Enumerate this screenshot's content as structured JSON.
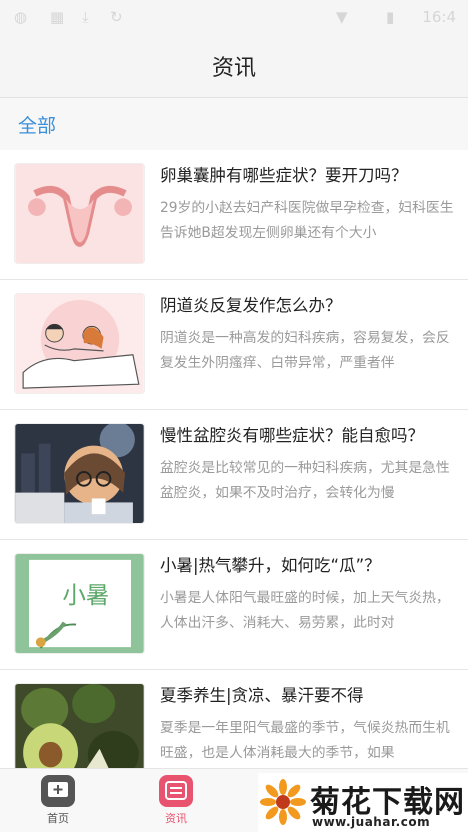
{
  "status_bar": {
    "time": "16:4",
    "icons": [
      "app-icon",
      "sim-icon",
      "download-icon",
      "sync-icon",
      "wifi-icon",
      "battery-icon"
    ]
  },
  "header": {
    "title": "资讯"
  },
  "filter": {
    "label": "全部"
  },
  "articles": [
    {
      "title": "卵巢囊肿有哪些症状？要开刀吗？",
      "desc": "29岁的小赵去妇产科医院做早孕检查，妇科医生告诉她B超发现左侧卵巢还有个大小",
      "thumb": "uterus-illustration"
    },
    {
      "title": "阴道炎反复发作怎么办？",
      "desc": "阴道炎是一种高发的妇科疾病，容易复发，会反复发生外阴瘙痒、白带异常，严重者伴",
      "thumb": "couple-illustration"
    },
    {
      "title": "慢性盆腔炎有哪些症状？能自愈吗？",
      "desc": "盆腔炎是比较常见的一种妇科疾病，尤其是急性盆腔炎，如果不及时治疗，会转化为慢",
      "thumb": "tired-woman-illustration"
    },
    {
      "title": "小暑|热气攀升，如何吃“瓜”？",
      "desc": "小暑是人体阳气最旺盛的时候，加上天气炎热，人体出汗多、消耗大、易劳累，此时对",
      "thumb": "xiaoshu-poster",
      "thumb_text": "小暑"
    },
    {
      "title": "夏季养生|贪凉、暴汗要不得",
      "desc": "夏季是一年里阳气最盛的季节，气候炎热而生机旺盛，也是人体消耗最大的季节，如果",
      "thumb": "avocado-photo"
    }
  ],
  "tabs": [
    {
      "label": "首页",
      "icon": "plus-square-icon",
      "active": false
    },
    {
      "label": "资讯",
      "icon": "news-icon",
      "active": true
    }
  ],
  "watermark": {
    "name": "菊花下载网",
    "url": "www.juahar.com"
  },
  "colors": {
    "accent": "#3b8fd8",
    "tab_active": "#e8536f"
  }
}
